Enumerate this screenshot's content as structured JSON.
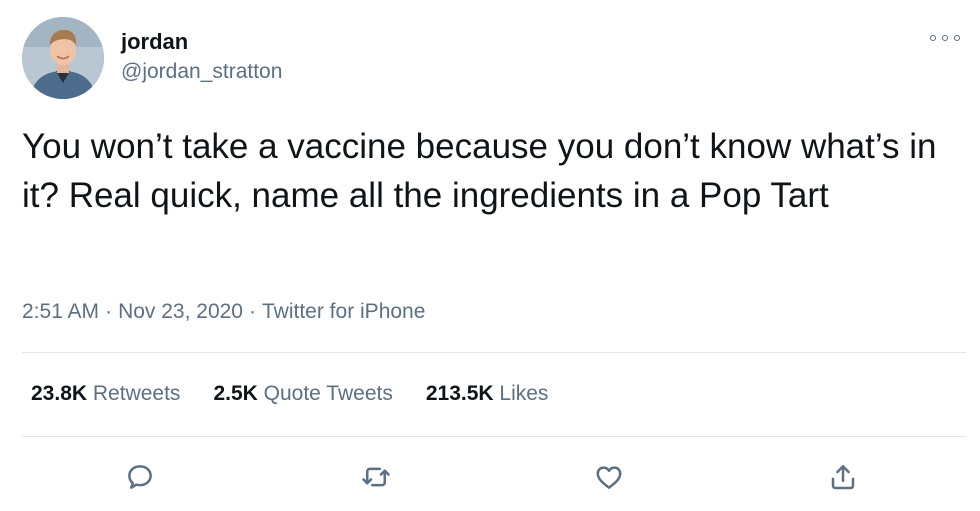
{
  "author": {
    "display_name": "jordan",
    "handle": "@jordan_stratton"
  },
  "tweet": {
    "text": "You won’t take a vaccine because you don’t know what’s in it? Real quick, name all the ingredients in a Pop Tart",
    "time": "2:51 AM",
    "date": "Nov 23, 2020",
    "source": "Twitter for iPhone",
    "separator": "·"
  },
  "stats": {
    "retweets_count": "23.8K",
    "retweets_label": "Retweets",
    "quotes_count": "2.5K",
    "quotes_label": "Quote Tweets",
    "likes_count": "213.5K",
    "likes_label": "Likes"
  },
  "icons": {
    "more": "more-icon",
    "reply": "reply-icon",
    "retweet": "retweet-icon",
    "like": "heart-icon",
    "share": "share-icon"
  },
  "colors": {
    "text": "#0f1419",
    "secondary": "#5b7083",
    "divider": "#e1e8ed"
  }
}
